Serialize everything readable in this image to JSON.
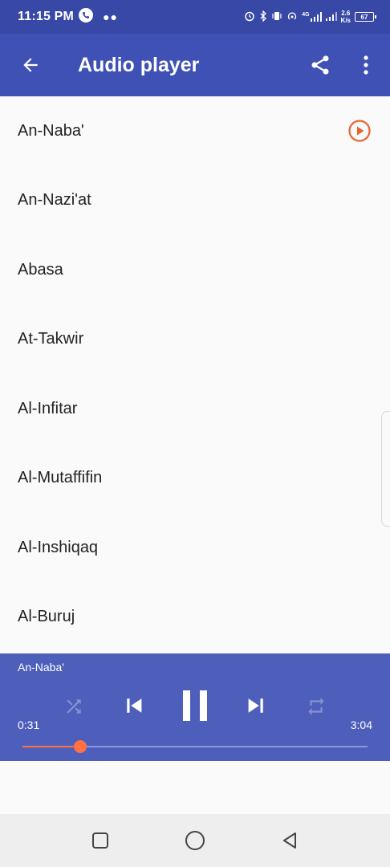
{
  "status_bar": {
    "time": "11:15 PM",
    "network_speed_value": "2.6",
    "network_speed_unit": "K/s",
    "battery": "67",
    "signal_label": "4G"
  },
  "app_bar": {
    "title": "Audio player",
    "icons": [
      "back-arrow-icon",
      "share-icon",
      "more-vert-icon"
    ]
  },
  "tracks": [
    {
      "label": "An-Naba'",
      "playing": true
    },
    {
      "label": "An-Nazi'at"
    },
    {
      "label": "Abasa"
    },
    {
      "label": "At-Takwir"
    },
    {
      "label": "Al-Infitar"
    },
    {
      "label": "Al-Mutaffifin"
    },
    {
      "label": "Al-Inshiqaq"
    },
    {
      "label": "Al-Buruj"
    }
  ],
  "player": {
    "now_playing": "An-Naba'",
    "elapsed": "0:31",
    "duration": "3:04",
    "progress": 0.168,
    "shuffle_enabled": false,
    "repeat_enabled": false,
    "state": "playing"
  },
  "colors": {
    "status_bar": "#3848a6",
    "app_bar": "#3f51b5",
    "player_bg": "#4e5fbb",
    "accent": "#ff7043",
    "play_icon": "#e8652f"
  }
}
